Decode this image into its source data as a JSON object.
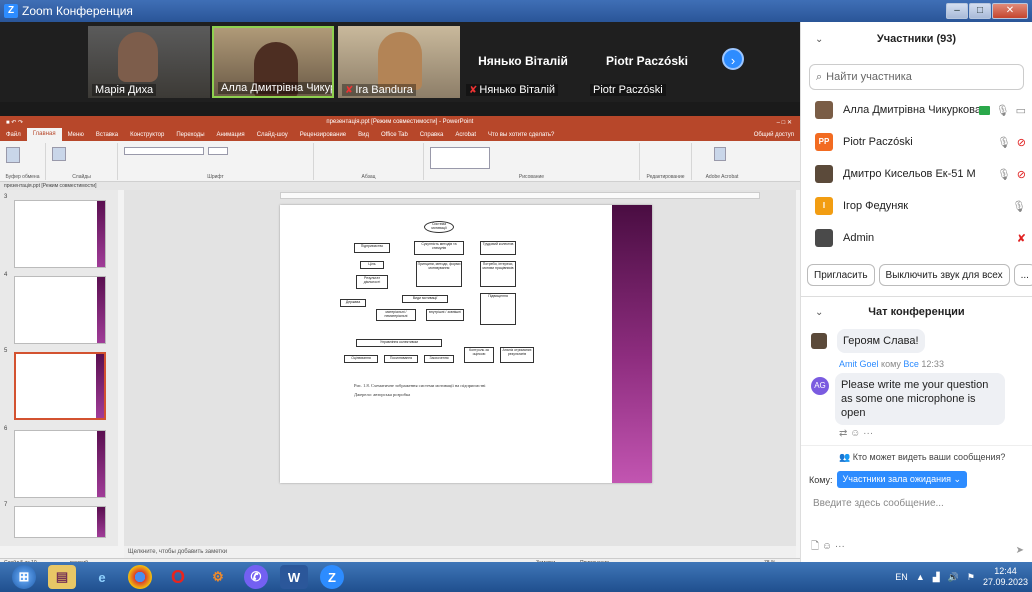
{
  "window": {
    "title": "Zoom Конференция",
    "buttons": {
      "minimize": "–",
      "maximize": "□",
      "close": "✕"
    }
  },
  "video_tiles": [
    {
      "name": "Марія Диха",
      "kind": "video",
      "color": "#6a6a6a"
    },
    {
      "name": "Алла Дмитрівна Чикурк...",
      "kind": "video",
      "color": "#8a7b63"
    },
    {
      "name": "Ira Bandura",
      "kind": "video",
      "color": "#9b8e76",
      "muted": true
    },
    {
      "name": "Нянько Віталій",
      "kind": "name",
      "muted": true
    },
    {
      "name": "Piotr Paczóski",
      "kind": "name"
    }
  ],
  "ppt": {
    "title": "презентація.ppt [Режим совместимости] - PowerPoint",
    "tabs": [
      "Файл",
      "Главная",
      "Меню",
      "Вставка",
      "Конструктор",
      "Переходы",
      "Анимация",
      "Слайд-шоу",
      "Рецензирование",
      "Вид",
      "Office Tab",
      "Справка",
      "Acrobat",
      "Что вы хотите сделать?"
    ],
    "active_tab": "Главная",
    "share": "Общий доступ",
    "ribbon_groups": [
      "Буфер обмена",
      "Слайды",
      "Шрифт",
      "Абзац",
      "Рисование",
      "Редактирование",
      "Adobe Acrobat"
    ],
    "file_tab": "презентація.ppt [Режим совместимости]",
    "slide_numbers": [
      "3",
      "4",
      "5",
      "6",
      "7"
    ],
    "notes_placeholder": "Щелкните, чтобы добавить заметки",
    "status_left": "Слайд 5 из 10",
    "status_lang": "русский",
    "status_notes": "Заметки",
    "status_comments": "Примечания",
    "zoom": "78 %",
    "slide": {
      "caption_line1": "Рис. 1.8. Схематичне зображення системи мотивації на підприємстві",
      "caption_line2": "Джерело: авторська розробка",
      "boxes": [
        "Система мотивації",
        "Підприємство",
        "Сукупність методів та стимулів",
        "Трудовий колектив",
        "Ціль",
        "Принципи, методи, форми мотивування",
        "Потреби, інтереси, мотиви працівників",
        "Результат діяльності",
        "Держава",
        "Види мотивації",
        "матеріальні / нематеріальні",
        "внутрішні / зовнішні",
        "Управління колективом",
        "Оцінювання",
        "Посилювання",
        "Заохочення",
        "Контроль за оцінкою",
        "Аналіз отриманих результатів",
        "Підвищення"
      ]
    }
  },
  "participants": {
    "header": "Участники (93)",
    "search_placeholder": "Найти участника",
    "list": [
      {
        "name": "Алла Дмитрівна Чикуркова",
        "avatar": "photo",
        "avatar_color": "#7a5d46"
      },
      {
        "name": "Piotr Paczóski",
        "avatar": "PP",
        "avatar_color": "#f26b21"
      },
      {
        "name": "Дмитро Кисельов Ек-51 М",
        "avatar": "photo",
        "avatar_color": "#5b4a3a"
      },
      {
        "name": "Ігор Федуняк",
        "avatar": "I",
        "avatar_color": "#f29d12"
      },
      {
        "name": "Admin",
        "avatar": "photo",
        "avatar_color": "#4a4a4a"
      }
    ],
    "invite": "Пригласить",
    "mute_all": "Выключить звук для всех",
    "more": "..."
  },
  "chat": {
    "header": "Чат конференции",
    "msg1": "Героям Слава!",
    "msg2_sender": "Amit Goel",
    "msg2_to_label": "кому",
    "msg2_to": "Все",
    "msg2_time": "12:33",
    "msg2_avatar": "AG",
    "msg2_text": "Please write me your question as some one microphone is open",
    "who_can_see": "Кто может видеть ваши сообщения?",
    "to_label": "Кому:",
    "to_value": "Участники зала ожидания",
    "input_placeholder": "Введите здесь сообщение..."
  },
  "taskbar": {
    "apps": [
      "start",
      "explorer",
      "ie",
      "chrome",
      "opera",
      "app",
      "viber",
      "word",
      "zoom"
    ],
    "lang": "EN",
    "time": "12:44",
    "date": "27.09.2023"
  },
  "colors": {
    "zoom_blue": "#2d8cff",
    "ppt_red": "#b7472a",
    "slide_purple": "#8e2d7f"
  }
}
